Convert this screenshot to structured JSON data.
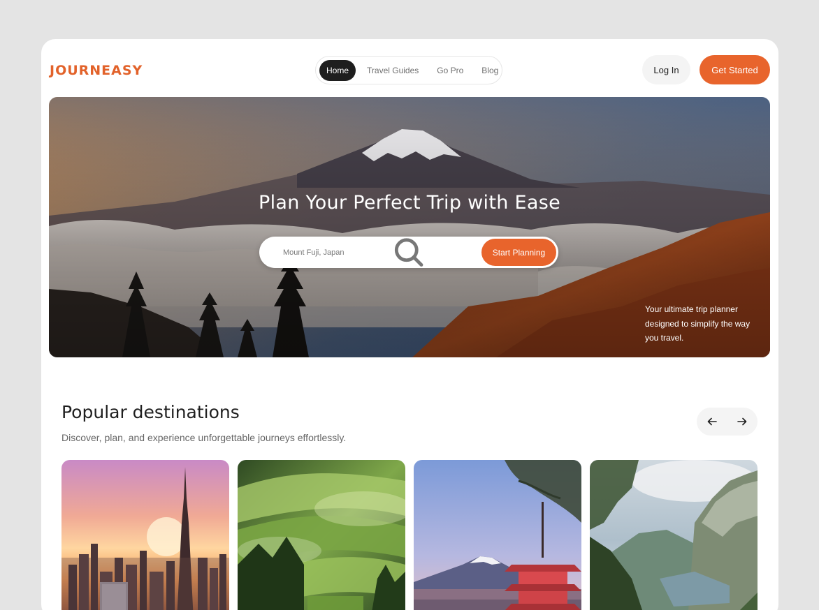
{
  "brand": {
    "name": "JOURNEASY",
    "accent_color": "#e8642c"
  },
  "nav": {
    "items": [
      {
        "label": "Home",
        "active": true
      },
      {
        "label": "Travel Guides",
        "active": false
      },
      {
        "label": "Go Pro",
        "active": false
      },
      {
        "label": "Blog",
        "active": false
      }
    ]
  },
  "header": {
    "login_label": "Log In",
    "get_started_label": "Get Started"
  },
  "hero": {
    "title": "Plan Your Perfect Trip with Ease",
    "search": {
      "icon": "search-icon",
      "placeholder": "Mount Fuji, Japan",
      "value": ""
    },
    "start_planning_label": "Start Planning",
    "tagline": "Your ultimate trip planner designed to simplify the way you travel."
  },
  "destinations": {
    "title": "Popular destinations",
    "subtitle": "Discover, plan, and experience unforgettable journeys effortlessly.",
    "prev_icon": "arrow-left-icon",
    "next_icon": "arrow-right-icon"
  }
}
